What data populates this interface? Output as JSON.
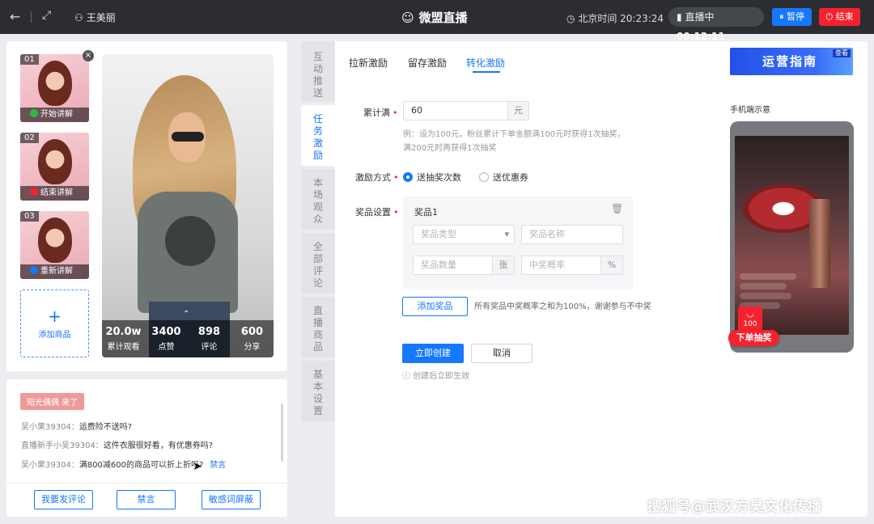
{
  "topbar": {
    "back_icon": "←",
    "fullscreen_icon": "⤢",
    "user_icon": "⚇",
    "username": "王美丽",
    "app_icon": "☺",
    "title": "微盟直播",
    "clock_icon": "◷",
    "time_label": "北京时间 20:23:24",
    "live_icon": "▮",
    "live_label": "直播中",
    "live_time": "00:12:11",
    "pause_label": "暂停",
    "end_label": "结束"
  },
  "video": {
    "thumbs": [
      {
        "num": "01",
        "action": "开始讲解",
        "color": "#2db84d"
      },
      {
        "num": "02",
        "action": "结束讲解",
        "color": "#f5222d"
      },
      {
        "num": "03",
        "action": "重新讲解",
        "color": "#1677ff"
      }
    ],
    "close_icon": "×",
    "add_product_icon": "+",
    "add_product_label": "添加商品",
    "stats": [
      {
        "value": "20.0w",
        "label": "累计观看"
      },
      {
        "value": "3400",
        "label": "点赞"
      },
      {
        "value": "898",
        "label": "评论"
      },
      {
        "value": "600",
        "label": "分享"
      }
    ],
    "caret_icon": "⌃"
  },
  "chat": {
    "welcome": "阳光偶偶 来了",
    "messages": [
      {
        "user": "吴小果39304：",
        "text": "运费险不送吗?"
      },
      {
        "user": "直播新手小吴39304：",
        "text": "这件衣服很好看，有优惠券吗?"
      },
      {
        "user": "吴小果39304：",
        "text": "满800减600的商品可以折上折吗?",
        "action": "禁言"
      }
    ],
    "buttons": {
      "comment": "我要发评论",
      "mute": "禁言",
      "filter": "敏感词屏蔽"
    }
  },
  "side_tabs": [
    {
      "label": "互动推送"
    },
    {
      "label": "任务激励"
    },
    {
      "label": "本场观众"
    },
    {
      "label": "全部评论"
    },
    {
      "label": "直播商品"
    },
    {
      "label": "基本设置"
    }
  ],
  "tabs": [
    {
      "label": "拉新激励"
    },
    {
      "label": "留存激励"
    },
    {
      "label": "转化激励"
    }
  ],
  "form": {
    "total_label": "累计满",
    "total_value": "60",
    "total_unit": "元",
    "hint_line1": "例：设为100元，粉丝累计下单金额满100元时获得1次抽奖，",
    "hint_line2": "满200元时再获得1次抽奖",
    "method_label": "激励方式",
    "method_options": [
      "送抽奖次数",
      "送优惠券"
    ],
    "prize_label": "奖品设置",
    "prize_title": "奖品1",
    "trash_icon": "🗑",
    "prize_type_placeholder": "奖品类型",
    "dropdown_icon": "▾",
    "prize_name_placeholder": "奖品名称",
    "prize_qty_placeholder": "奖品数量",
    "prize_qty_unit": "张",
    "prize_rate_placeholder": "中奖概率",
    "prize_rate_unit": "%",
    "add_prize": "添加奖品",
    "add_prize_hint": "所有奖品中奖概率之和为100%，谢谢参与不中奖",
    "create": "立即创建",
    "cancel": "取消",
    "info_icon": "ⓘ",
    "create_hint": "创建后立即生效"
  },
  "preview": {
    "guide_label": "运营指南",
    "guide_view": "查看",
    "phone_label": "手机端示意",
    "lottery_icon": "◡",
    "lottery_count": "100",
    "order_badge": "下单抽奖"
  },
  "watermark": "搜狐号@武汉方昊文化传播"
}
